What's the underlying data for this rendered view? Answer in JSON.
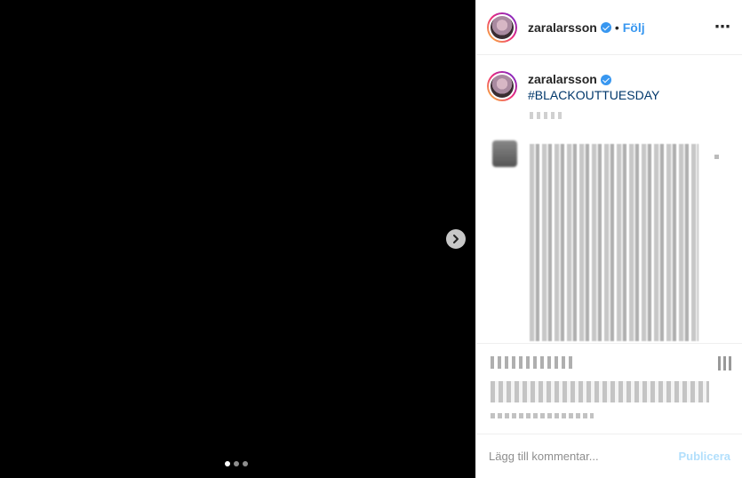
{
  "post": {
    "media": {
      "carousel_slide_index": 1,
      "carousel_slide_count": 3
    },
    "header": {
      "username": "zaralarsson",
      "separator": "•",
      "follow_label": "Följ",
      "more_icon": "⋯"
    },
    "caption": {
      "username": "zaralarsson",
      "hashtag": "#BLACKOUTTUESDAY"
    },
    "comment": {
      "placeholder": "Lägg till kommentar...",
      "publish_label": "Publicera"
    },
    "colors": {
      "accent": "#3897f0",
      "hashtag": "#00376b",
      "publish_disabled": "#b2dffc"
    }
  }
}
